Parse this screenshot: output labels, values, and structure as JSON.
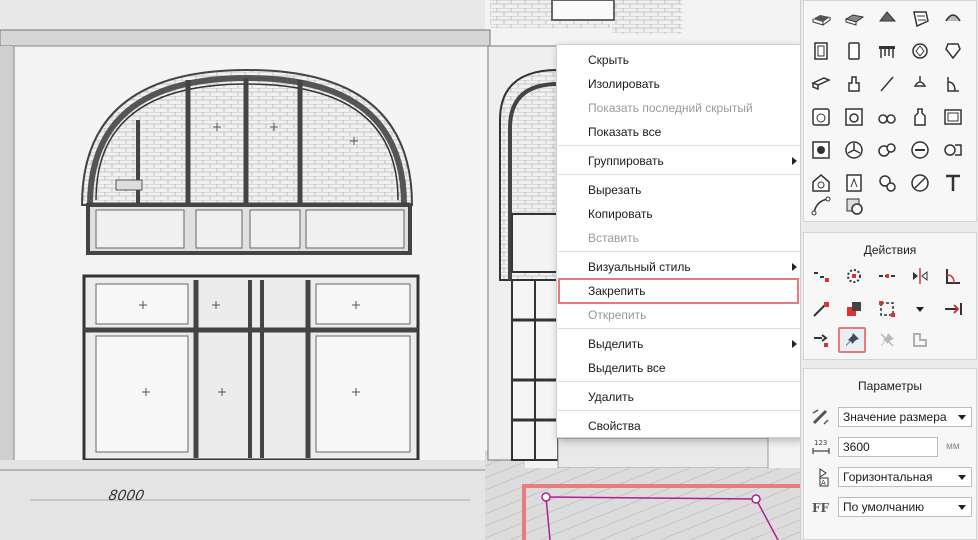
{
  "context_menu": {
    "items": [
      {
        "label": "Скрыть",
        "enabled": true,
        "submenu": false
      },
      {
        "label": "Изолировать",
        "enabled": true,
        "submenu": false
      },
      {
        "label": "Показать последний скрытый",
        "enabled": false,
        "submenu": false
      },
      {
        "label": "Показать все",
        "enabled": true,
        "submenu": false
      },
      {
        "label": "Группировать",
        "enabled": true,
        "submenu": true
      },
      {
        "label": "Вырезать",
        "enabled": true,
        "submenu": false
      },
      {
        "label": "Копировать",
        "enabled": true,
        "submenu": false
      },
      {
        "label": "Вставить",
        "enabled": false,
        "submenu": false
      },
      {
        "label": "Визуальный стиль",
        "enabled": true,
        "submenu": true
      },
      {
        "label": "Закрепить",
        "enabled": true,
        "submenu": false,
        "highlighted": true
      },
      {
        "label": "Открепить",
        "enabled": false,
        "submenu": false
      },
      {
        "label": "Выделить",
        "enabled": true,
        "submenu": true
      },
      {
        "label": "Выделить все",
        "enabled": true,
        "submenu": false
      },
      {
        "label": "Удалить",
        "enabled": true,
        "submenu": false
      },
      {
        "label": "Свойства",
        "enabled": true,
        "submenu": false
      }
    ]
  },
  "actions_panel": {
    "title": "Действия"
  },
  "params_panel": {
    "title": "Параметры",
    "dimension_mode": "Значение размера",
    "value": "3600",
    "unit": "мм",
    "orientation": "Горизонтальная",
    "style": "По умолчанию"
  },
  "viewport": {
    "dimension_label": "8000"
  },
  "colors": {
    "highlight": "#e8797b",
    "accent_magenta": "#b0208f"
  }
}
